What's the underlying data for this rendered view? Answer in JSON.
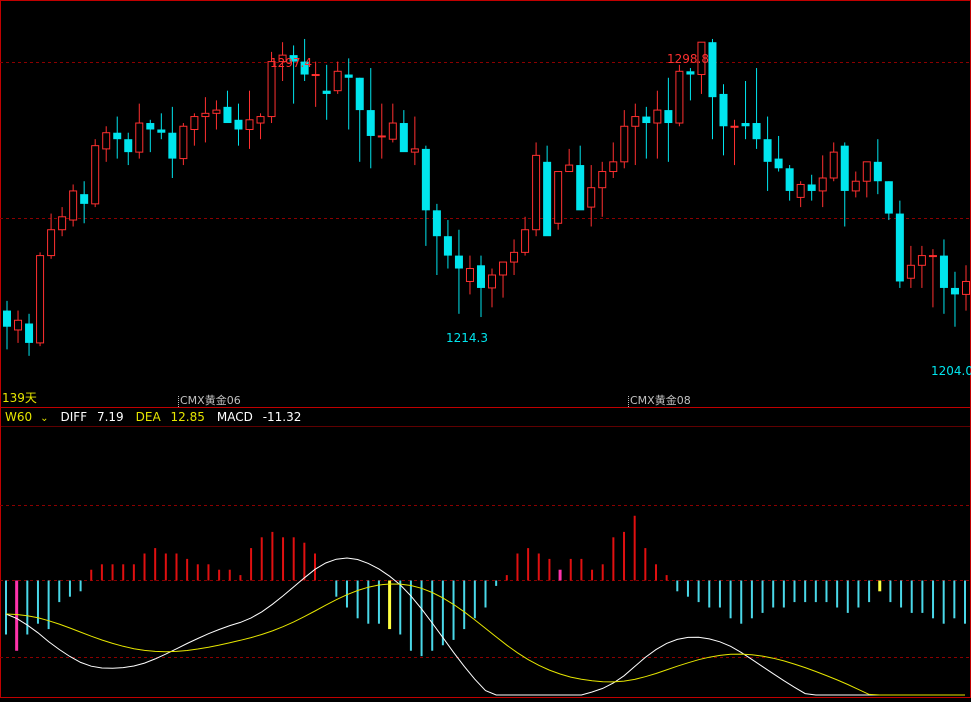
{
  "colors": {
    "background": "#000000",
    "up": "#ff3030",
    "down": "#00e5ee",
    "grid": "#8b0000",
    "frame": "#c00000",
    "diff": "#ffffff",
    "dea": "#e6e600",
    "macd_up": "#e01010",
    "macd_down": "#4ad8e8",
    "highlight_up": "#ffff40",
    "highlight_down": "#ff33aa",
    "label": "#c0c0c0"
  },
  "price_panel": {
    "high_label_1": "1297.4",
    "high_label_2": "1298.8",
    "low_label_1": "1214.3",
    "low_label_2": "1204.0",
    "period_count": "139天",
    "contract_1": "CMX黄金06",
    "contract_2": "CMX黄金08"
  },
  "indicator": {
    "period_button": "W60",
    "diff_label": "DIFF",
    "diff_value": "7.19",
    "dea_label": "DEA",
    "dea_value": "12.85",
    "macd_label": "MACD",
    "macd_value": "-11.32"
  },
  "chart_data": [
    {
      "type": "candlestick",
      "ohlc": [
        [
          1223,
          1226,
          1211,
          1218
        ],
        [
          1217,
          1223,
          1213,
          1220
        ],
        [
          1219,
          1222,
          1209,
          1213
        ],
        [
          1213,
          1241,
          1212,
          1240
        ],
        [
          1240,
          1253,
          1239,
          1248
        ],
        [
          1248,
          1255,
          1246,
          1252
        ],
        [
          1251,
          1262,
          1249,
          1260
        ],
        [
          1259,
          1263,
          1250,
          1256
        ],
        [
          1256,
          1276,
          1255,
          1274
        ],
        [
          1273,
          1280,
          1269,
          1278
        ],
        [
          1278,
          1283,
          1270,
          1276
        ],
        [
          1276,
          1278,
          1268,
          1272
        ],
        [
          1272,
          1287,
          1270,
          1281
        ],
        [
          1281,
          1282,
          1272,
          1279
        ],
        [
          1279,
          1284,
          1276,
          1278
        ],
        [
          1278,
          1286,
          1264,
          1270
        ],
        [
          1270,
          1281,
          1268,
          1280
        ],
        [
          1279,
          1284,
          1274,
          1283
        ],
        [
          1283,
          1289,
          1275,
          1284
        ],
        [
          1284,
          1288,
          1279,
          1285
        ],
        [
          1286,
          1291,
          1282,
          1281
        ],
        [
          1282,
          1287,
          1274,
          1279
        ],
        [
          1279,
          1291,
          1273,
          1282
        ],
        [
          1281,
          1284,
          1276,
          1283
        ],
        [
          1283,
          1303,
          1281,
          1300
        ],
        [
          1300,
          1306,
          1294,
          1302
        ],
        [
          1302,
          1305,
          1287,
          1300
        ],
        [
          1300,
          1307,
          1294,
          1296
        ],
        [
          1296,
          1300,
          1286,
          1296
        ],
        [
          1291,
          1299,
          1282,
          1290
        ],
        [
          1291,
          1300,
          1290,
          1297
        ],
        [
          1296,
          1301,
          1279,
          1295
        ],
        [
          1295,
          1295,
          1269,
          1285
        ],
        [
          1285,
          1298,
          1267,
          1277
        ],
        [
          1277,
          1287,
          1270,
          1277
        ],
        [
          1276,
          1287,
          1275,
          1281
        ],
        [
          1281,
          1285,
          1273,
          1272
        ],
        [
          1272,
          1283,
          1268,
          1273
        ],
        [
          1273,
          1274,
          1243,
          1254
        ],
        [
          1254,
          1256,
          1234,
          1246
        ],
        [
          1246,
          1251,
          1236,
          1240
        ],
        [
          1240,
          1248,
          1222,
          1236
        ],
        [
          1232,
          1240,
          1228,
          1236
        ],
        [
          1237,
          1240,
          1221,
          1230
        ],
        [
          1230,
          1236,
          1224,
          1234
        ],
        [
          1234,
          1238,
          1227,
          1238
        ],
        [
          1238,
          1245,
          1234,
          1241
        ],
        [
          1241,
          1252,
          1240,
          1248
        ],
        [
          1248,
          1275,
          1246,
          1271
        ],
        [
          1269,
          1274,
          1248,
          1246
        ],
        [
          1250,
          1266,
          1248,
          1266
        ],
        [
          1266,
          1273,
          1266,
          1268
        ],
        [
          1268,
          1274,
          1267,
          1254
        ],
        [
          1255,
          1268,
          1249,
          1261
        ],
        [
          1261,
          1269,
          1252,
          1266
        ],
        [
          1266,
          1275,
          1264,
          1269
        ],
        [
          1269,
          1285,
          1267,
          1280
        ],
        [
          1280,
          1287,
          1268,
          1283
        ],
        [
          1283,
          1286,
          1270,
          1281
        ],
        [
          1281,
          1291,
          1270,
          1285
        ],
        [
          1285,
          1295,
          1269,
          1281
        ],
        [
          1281,
          1299,
          1280,
          1297
        ],
        [
          1297,
          1298,
          1288,
          1296
        ],
        [
          1296,
          1299,
          1290,
          1306
        ],
        [
          1306,
          1307,
          1276,
          1289
        ],
        [
          1290,
          1293,
          1271,
          1280
        ],
        [
          1280,
          1282,
          1268,
          1280
        ],
        [
          1281,
          1294,
          1276,
          1280
        ],
        [
          1281,
          1298,
          1273,
          1276
        ],
        [
          1276,
          1283,
          1260,
          1269
        ],
        [
          1270,
          1277,
          1266,
          1267
        ],
        [
          1267,
          1268,
          1257,
          1260
        ],
        [
          1258,
          1263,
          1255,
          1262
        ],
        [
          1262,
          1265,
          1257,
          1260
        ],
        [
          1260,
          1271,
          1255,
          1264
        ],
        [
          1264,
          1275,
          1263,
          1272
        ],
        [
          1274,
          1275,
          1249,
          1260
        ],
        [
          1260,
          1266,
          1258,
          1263
        ],
        [
          1263,
          1269,
          1258,
          1269
        ],
        [
          1269,
          1276,
          1259,
          1263
        ],
        [
          1263,
          1263,
          1251,
          1253
        ],
        [
          1253,
          1257,
          1230,
          1232
        ],
        [
          1233,
          1243,
          1230,
          1237
        ],
        [
          1237,
          1243,
          1230,
          1240
        ],
        [
          1240,
          1242,
          1224,
          1240
        ],
        [
          1240,
          1245,
          1222,
          1230
        ],
        [
          1230,
          1235,
          1218,
          1228
        ],
        [
          1228,
          1237,
          1223,
          1232
        ]
      ]
    },
    {
      "type": "bar",
      "name": "MACD",
      "values": [
        -10,
        -13,
        -10,
        -8,
        -9,
        -4,
        -3,
        -2,
        2,
        3,
        3,
        3,
        3,
        5,
        6,
        5,
        5,
        4,
        3,
        3,
        2,
        2,
        1,
        6,
        8,
        9,
        8,
        8,
        7,
        5,
        0,
        -3,
        -5,
        -7,
        -8,
        -8,
        -9,
        -10,
        -13,
        -14,
        -13,
        -12,
        -11,
        -9,
        -7,
        -5,
        -1,
        1,
        5,
        6,
        5,
        4,
        2,
        4,
        4,
        2,
        3,
        8,
        9,
        12,
        6,
        3,
        1,
        -2,
        -3,
        -4,
        -5,
        -5,
        -7,
        -8,
        -7,
        -6,
        -5,
        -5,
        -4,
        -4,
        -4,
        -4,
        -5,
        -6,
        -5,
        -4,
        -2,
        -4,
        -5,
        -6,
        -6,
        -7,
        -8,
        -7,
        -8
      ],
      "highlight_up_index": [
        36,
        82
      ],
      "highlight_down_index": [
        1,
        52,
        106
      ]
    }
  ]
}
